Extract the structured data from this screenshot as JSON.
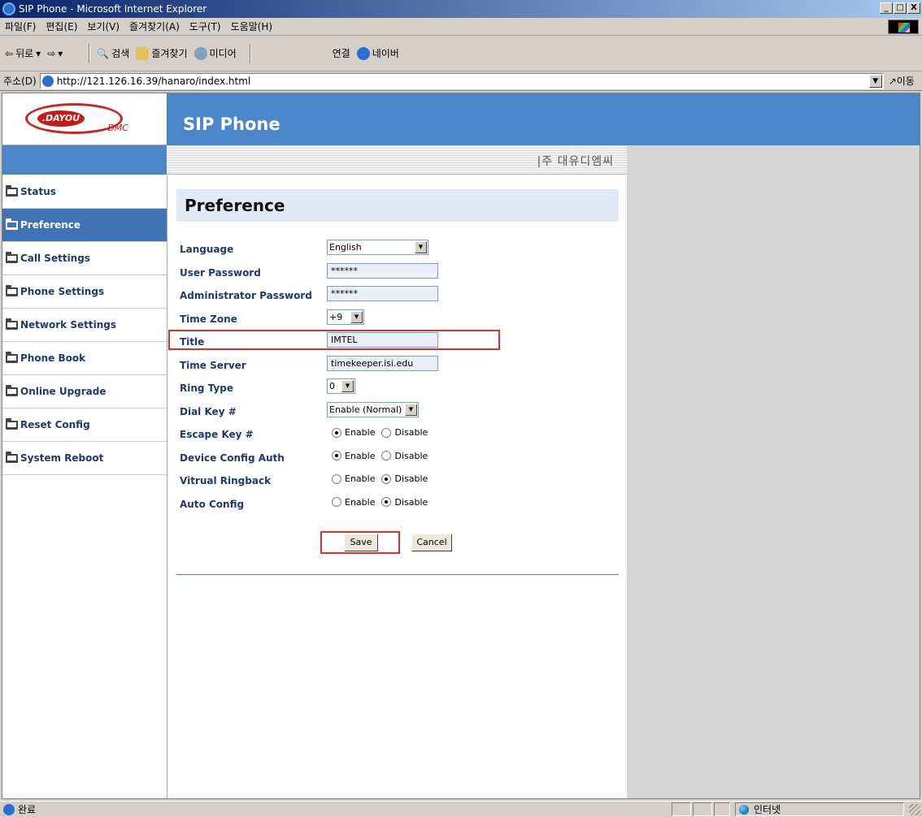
{
  "window": {
    "title": "SIP Phone - Microsoft Internet Explorer",
    "controls": [
      "_",
      "□",
      "X"
    ]
  },
  "menubar": [
    "파일(F)",
    "편집(E)",
    "보기(V)",
    "즐겨찾기(A)",
    "도구(T)",
    "도움말(H)"
  ],
  "toolbar": {
    "back": "뒤로",
    "search": "검색",
    "favorites": "즐겨찾기",
    "media": "미디어",
    "links_label": "연결",
    "naver": "네이버"
  },
  "address": {
    "label": "주소(D)",
    "url": "http://121.126.16.39/hanaro/index.html",
    "go": "이동"
  },
  "header": {
    "logo_brand": ".DAYOU",
    "logo_sub": "DMC",
    "site_title": "SIP Phone",
    "company": "|주 대유디엠씨"
  },
  "sidebar": {
    "items": [
      {
        "label": "Status",
        "active": false
      },
      {
        "label": "Preference",
        "active": true
      },
      {
        "label": "Call Settings",
        "active": false
      },
      {
        "label": "Phone Settings",
        "active": false
      },
      {
        "label": "Network Settings",
        "active": false
      },
      {
        "label": "Phone Book",
        "active": false
      },
      {
        "label": "Online Upgrade",
        "active": false
      },
      {
        "label": "Reset Config",
        "active": false
      },
      {
        "label": "System Reboot",
        "active": false
      }
    ]
  },
  "preference": {
    "heading": "Preference",
    "language": {
      "label": "Language",
      "value": "English"
    },
    "user_password": {
      "label": "User Password",
      "value": "******"
    },
    "admin_password": {
      "label": "Administrator Password",
      "value": "******"
    },
    "time_zone": {
      "label": "Time Zone",
      "value": "+9"
    },
    "title": {
      "label": "Title",
      "value": "IMTEL"
    },
    "time_server": {
      "label": "Time Server",
      "value": "timekeeper.isi.edu"
    },
    "ring_type": {
      "label": "Ring Type",
      "value": "0"
    },
    "dial_key": {
      "label": "Dial Key #",
      "value": "Enable (Normal)"
    },
    "escape_key": {
      "label": "Escape Key #",
      "selected": "Enable"
    },
    "device_config_auth": {
      "label": "Device Config Auth",
      "selected": "Enable"
    },
    "virtual_ringback": {
      "label": "Vitrual Ringback",
      "selected": "Disable"
    },
    "auto_config": {
      "label": "Auto Config",
      "selected": "Disable"
    },
    "radio_enable": "Enable",
    "radio_disable": "Disable",
    "save": "Save",
    "cancel": "Cancel"
  },
  "statusbar": {
    "status": "완료",
    "zone": "인터넷"
  }
}
